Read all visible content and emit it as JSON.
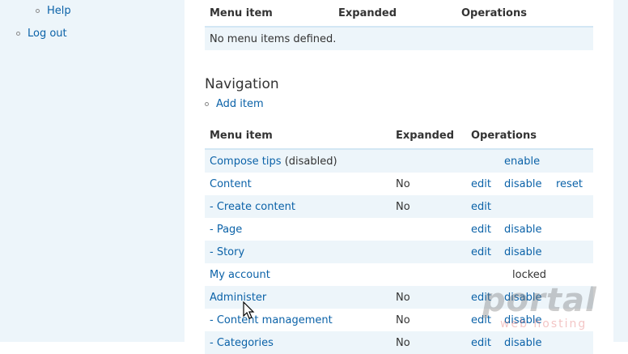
{
  "sidebar": {
    "items": [
      {
        "label": "Help"
      },
      {
        "label": "Log out"
      }
    ]
  },
  "top_table": {
    "headers": {
      "menu_item": "Menu item",
      "expanded": "Expanded",
      "operations": "Operations"
    },
    "empty_message": "No menu items defined."
  },
  "navigation": {
    "title": "Navigation",
    "add_item": "Add item",
    "headers": {
      "menu_item": "Menu item",
      "expanded": "Expanded",
      "operations": "Operations"
    },
    "rows": [
      {
        "item": "Compose tips",
        "suffix": "(disabled)",
        "expanded": "",
        "op1": "",
        "op2": "enable",
        "op3": ""
      },
      {
        "item": "Content",
        "suffix": "",
        "expanded": "No",
        "op1": "edit",
        "op2": "disable",
        "op3": "reset"
      },
      {
        "item": "- Create content",
        "suffix": "",
        "expanded": "No",
        "op1": "edit",
        "op2": "",
        "op3": ""
      },
      {
        "item": "- Page",
        "suffix": "",
        "expanded": "",
        "op1": "edit",
        "op2": "disable",
        "op3": ""
      },
      {
        "item": "- Story",
        "suffix": "",
        "expanded": "",
        "op1": "edit",
        "op2": "disable",
        "op3": ""
      },
      {
        "item": "My account",
        "suffix": "",
        "expanded": "",
        "op1": "",
        "op2": "locked",
        "op3": ""
      },
      {
        "item": "Administer",
        "suffix": "",
        "expanded": "No",
        "op1": "edit",
        "op2": "disable",
        "op3": ""
      },
      {
        "item": "- Content management",
        "suffix": "",
        "expanded": "No",
        "op1": "edit",
        "op2": "disable",
        "op3": ""
      },
      {
        "item": "- Categories",
        "suffix": "",
        "expanded": "No",
        "op1": "edit",
        "op2": "disable",
        "op3": ""
      }
    ]
  },
  "watermark": {
    "main": "portal",
    "sub": "web hosting"
  }
}
